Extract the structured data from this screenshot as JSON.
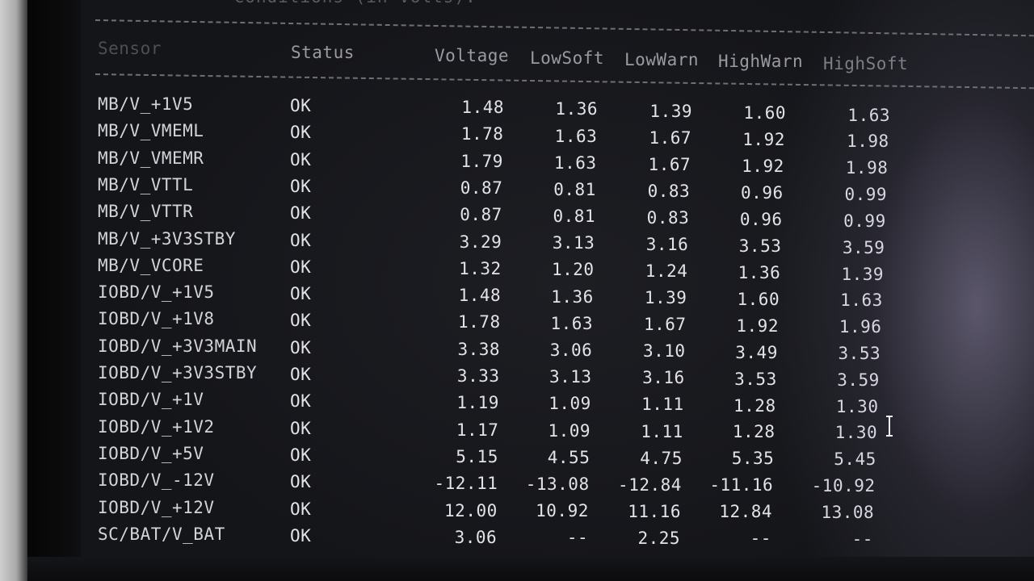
{
  "caption": "    Conditions (in Volts):",
  "headers": {
    "sensor": "Sensor",
    "status": "Status",
    "voltage": "Voltage",
    "lowsoft": "LowSoft",
    "lowwarn": "LowWarn",
    "highwarn": "HighWarn",
    "highsoft": "HighSoft"
  },
  "rows": [
    {
      "sensor": "MB/V_+1V5",
      "status": "OK",
      "voltage": "1.48",
      "lowsoft": "1.36",
      "lowwarn": "1.39",
      "highwarn": "1.60",
      "highsoft": "1.63"
    },
    {
      "sensor": "MB/V_VMEML",
      "status": "OK",
      "voltage": "1.78",
      "lowsoft": "1.63",
      "lowwarn": "1.67",
      "highwarn": "1.92",
      "highsoft": "1.98"
    },
    {
      "sensor": "MB/V_VMEMR",
      "status": "OK",
      "voltage": "1.79",
      "lowsoft": "1.63",
      "lowwarn": "1.67",
      "highwarn": "1.92",
      "highsoft": "1.98"
    },
    {
      "sensor": "MB/V_VTTL",
      "status": "OK",
      "voltage": "0.87",
      "lowsoft": "0.81",
      "lowwarn": "0.83",
      "highwarn": "0.96",
      "highsoft": "0.99"
    },
    {
      "sensor": "MB/V_VTTR",
      "status": "OK",
      "voltage": "0.87",
      "lowsoft": "0.81",
      "lowwarn": "0.83",
      "highwarn": "0.96",
      "highsoft": "0.99"
    },
    {
      "sensor": "MB/V_+3V3STBY",
      "status": "OK",
      "voltage": "3.29",
      "lowsoft": "3.13",
      "lowwarn": "3.16",
      "highwarn": "3.53",
      "highsoft": "3.59"
    },
    {
      "sensor": "MB/V_VCORE",
      "status": "OK",
      "voltage": "1.32",
      "lowsoft": "1.20",
      "lowwarn": "1.24",
      "highwarn": "1.36",
      "highsoft": "1.39"
    },
    {
      "sensor": "IOBD/V_+1V5",
      "status": "OK",
      "voltage": "1.48",
      "lowsoft": "1.36",
      "lowwarn": "1.39",
      "highwarn": "1.60",
      "highsoft": "1.63"
    },
    {
      "sensor": "IOBD/V_+1V8",
      "status": "OK",
      "voltage": "1.78",
      "lowsoft": "1.63",
      "lowwarn": "1.67",
      "highwarn": "1.92",
      "highsoft": "1.96"
    },
    {
      "sensor": "IOBD/V_+3V3MAIN",
      "status": "OK",
      "voltage": "3.38",
      "lowsoft": "3.06",
      "lowwarn": "3.10",
      "highwarn": "3.49",
      "highsoft": "3.53"
    },
    {
      "sensor": "IOBD/V_+3V3STBY",
      "status": "OK",
      "voltage": "3.33",
      "lowsoft": "3.13",
      "lowwarn": "3.16",
      "highwarn": "3.53",
      "highsoft": "3.59"
    },
    {
      "sensor": "IOBD/V_+1V",
      "status": "OK",
      "voltage": "1.19",
      "lowsoft": "1.09",
      "lowwarn": "1.11",
      "highwarn": "1.28",
      "highsoft": "1.30"
    },
    {
      "sensor": "IOBD/V_+1V2",
      "status": "OK",
      "voltage": "1.17",
      "lowsoft": "1.09",
      "lowwarn": "1.11",
      "highwarn": "1.28",
      "highsoft": "1.30"
    },
    {
      "sensor": "IOBD/V_+5V",
      "status": "OK",
      "voltage": "5.15",
      "lowsoft": "4.55",
      "lowwarn": "4.75",
      "highwarn": "5.35",
      "highsoft": "5.45"
    },
    {
      "sensor": "IOBD/V_-12V",
      "status": "OK",
      "voltage": "-12.11",
      "lowsoft": "-13.08",
      "lowwarn": "-12.84",
      "highwarn": "-11.16",
      "highsoft": "-10.92"
    },
    {
      "sensor": "IOBD/V_+12V",
      "status": "OK",
      "voltage": "12.00",
      "lowsoft": "10.92",
      "lowwarn": "11.16",
      "highwarn": "12.84",
      "highsoft": "13.08"
    },
    {
      "sensor": "SC/BAT/V_BAT",
      "status": "OK",
      "voltage": "3.06",
      "lowsoft": "--",
      "lowwarn": "2.25",
      "highwarn": "--",
      "highsoft": "--"
    }
  ],
  "colors": {
    "background": "#16171b",
    "text": "#e2e3e8",
    "header": "#9a9ba2"
  },
  "icons": {
    "cursor": "text-cursor-icon"
  }
}
